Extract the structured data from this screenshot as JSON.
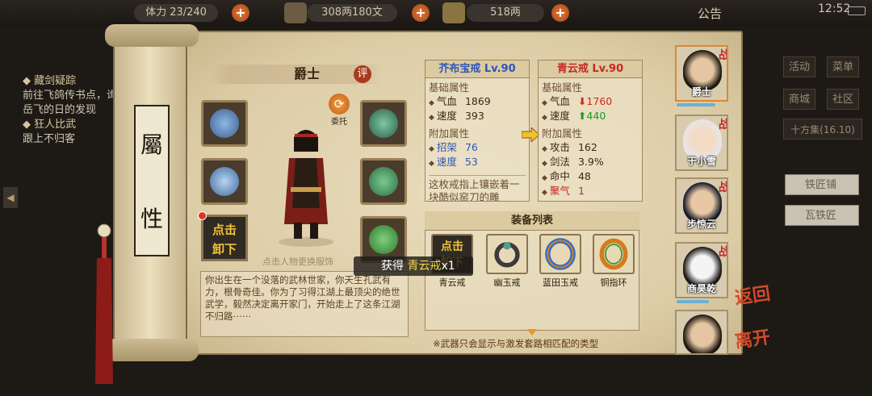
{
  "topbar": {
    "stamina": "体力 23/240",
    "coins": "308两180文",
    "gold": "518两",
    "notice": "公告",
    "time": "12:52"
  },
  "quests": [
    {
      "title": "藏剑疑踪",
      "desc": "前往飞鸽传书点，询问岳飞的日的发现"
    },
    {
      "title": "狂人比武",
      "desc": "跟上不归客"
    }
  ],
  "scroll": {
    "char1": "屬",
    "char2": "性"
  },
  "character": {
    "name": "爵士",
    "rate_label": "评",
    "entrust_label": "委托",
    "unequip_label_1": "点击",
    "unequip_label_2": "卸下",
    "change_hint": "点击人物更换服饰",
    "bio": "你出生在一个没落的武林世家，你天生孔武有力，根骨奇佳。你为了习得江湖上最顶尖的绝世武学，毅然决定离开家门，开始走上了这条江湖不归路⋯⋯"
  },
  "current_item": {
    "name": "芥布宝戒 Lv.90",
    "base_title": "基础属性",
    "base": [
      {
        "k": "气血",
        "v": "1869"
      },
      {
        "k": "速度",
        "v": "393"
      }
    ],
    "extra_title": "附加属性",
    "extra": [
      {
        "k": "招架",
        "v": "76"
      },
      {
        "k": "速度",
        "v": "53"
      }
    ],
    "desc": "这枚戒指上镶嵌着一块酷似窑刀的雕"
  },
  "new_item": {
    "name": "青云戒 Lv.90",
    "base_title": "基础属性",
    "base": [
      {
        "k": "气血",
        "v": "1760",
        "dir": "down"
      },
      {
        "k": "速度",
        "v": "440",
        "dir": "up"
      }
    ],
    "extra_title": "附加属性",
    "extra": [
      {
        "k": "攻击",
        "v": "162"
      },
      {
        "k": "剑法",
        "v": "3.9%"
      },
      {
        "k": "命中",
        "v": "48"
      },
      {
        "k": "聚气",
        "v": "1"
      }
    ]
  },
  "equip_list": {
    "title": "装备列表",
    "unequip_1": "点击",
    "unequip_2": "卸下",
    "items": [
      "青云戒",
      "幽玉戒",
      "蓝田玉戒",
      "铜指环"
    ],
    "note": "※武器只会显示与激发套路相匹配的类型"
  },
  "toast": {
    "prefix": "获得",
    "item": "青云戒",
    "count": "x1"
  },
  "roster": [
    {
      "name": "爵士",
      "tag": "战"
    },
    {
      "name": "于小雪",
      "tag": "战"
    },
    {
      "name": "步惊云",
      "tag": "战"
    },
    {
      "name": "商昊乾",
      "tag": "战"
    },
    {
      "name": "",
      "tag": ""
    }
  ],
  "side_menu": {
    "activity": "活动",
    "menu": "菜单",
    "shop": "商城",
    "community": "社区",
    "shifang": "十方集",
    "shifang_count": "(16.10)"
  },
  "smiths": [
    "铁匠铺",
    "瓦铁匠"
  ],
  "back_label": "返回",
  "leave_label": "离开",
  "colors": {
    "green_text": "#1d9a22",
    "red_text": "#d0291f",
    "blue_title": "#2d56b8",
    "accent": "#e0342a"
  }
}
